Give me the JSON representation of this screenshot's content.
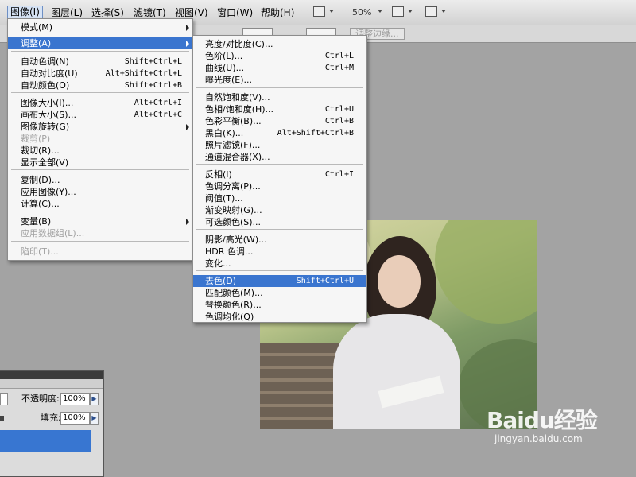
{
  "menubar": {
    "items": [
      "图像(I)",
      "图层(L)",
      "选择(S)",
      "滤镜(T)",
      "视图(V)",
      "窗口(W)",
      "帮助(H)"
    ],
    "zoom": "50%"
  },
  "options": {
    "adjust_edge": "调整边缘..."
  },
  "image_menu": {
    "items": [
      {
        "label": "模式(M)",
        "shortcut": ""
      },
      {
        "label": "调整(A)",
        "shortcut": ""
      },
      {
        "label": "自动色调(N)",
        "shortcut": "Shift+Ctrl+L"
      },
      {
        "label": "自动对比度(U)",
        "shortcut": "Alt+Shift+Ctrl+L"
      },
      {
        "label": "自动颜色(O)",
        "shortcut": "Shift+Ctrl+B"
      },
      {
        "label": "图像大小(I)...",
        "shortcut": "Alt+Ctrl+I"
      },
      {
        "label": "画布大小(S)...",
        "shortcut": "Alt+Ctrl+C"
      },
      {
        "label": "图像旋转(G)",
        "shortcut": ""
      },
      {
        "label": "裁剪(P)",
        "shortcut": ""
      },
      {
        "label": "裁切(R)...",
        "shortcut": ""
      },
      {
        "label": "显示全部(V)",
        "shortcut": ""
      },
      {
        "label": "复制(D)...",
        "shortcut": ""
      },
      {
        "label": "应用图像(Y)...",
        "shortcut": ""
      },
      {
        "label": "计算(C)...",
        "shortcut": ""
      },
      {
        "label": "变量(B)",
        "shortcut": ""
      },
      {
        "label": "应用数据组(L)...",
        "shortcut": ""
      },
      {
        "label": "陷印(T)...",
        "shortcut": ""
      }
    ]
  },
  "adjust_menu": {
    "items": [
      {
        "label": "亮度/对比度(C)...",
        "shortcut": ""
      },
      {
        "label": "色阶(L)...",
        "shortcut": "Ctrl+L"
      },
      {
        "label": "曲线(U)...",
        "shortcut": "Ctrl+M"
      },
      {
        "label": "曝光度(E)...",
        "shortcut": ""
      },
      {
        "label": "自然饱和度(V)...",
        "shortcut": ""
      },
      {
        "label": "色相/饱和度(H)...",
        "shortcut": "Ctrl+U"
      },
      {
        "label": "色彩平衡(B)...",
        "shortcut": "Ctrl+B"
      },
      {
        "label": "黑白(K)...",
        "shortcut": "Alt+Shift+Ctrl+B"
      },
      {
        "label": "照片滤镜(F)...",
        "shortcut": ""
      },
      {
        "label": "通道混合器(X)...",
        "shortcut": ""
      },
      {
        "label": "反相(I)",
        "shortcut": "Ctrl+I"
      },
      {
        "label": "色调分离(P)...",
        "shortcut": ""
      },
      {
        "label": "阈值(T)...",
        "shortcut": ""
      },
      {
        "label": "渐变映射(G)...",
        "shortcut": ""
      },
      {
        "label": "可选颜色(S)...",
        "shortcut": ""
      },
      {
        "label": "阴影/高光(W)...",
        "shortcut": ""
      },
      {
        "label": "HDR 色调...",
        "shortcut": ""
      },
      {
        "label": "变化...",
        "shortcut": ""
      },
      {
        "label": "去色(D)",
        "shortcut": "Shift+Ctrl+U"
      },
      {
        "label": "匹配颜色(M)...",
        "shortcut": ""
      },
      {
        "label": "替换颜色(R)...",
        "shortcut": ""
      },
      {
        "label": "色调均化(Q)",
        "shortcut": ""
      }
    ]
  },
  "layers_panel": {
    "opacity_label": "不透明度:",
    "opacity_value": "100%",
    "fill_label": "填充:",
    "fill_value": "100%"
  },
  "watermark": {
    "logo": "Baidu经验",
    "url": "jingyan.baidu.com"
  },
  "colors": {
    "highlight": "#3a75cf",
    "menu_bg": "#f6f6f6",
    "workspace": "#a3a3a3"
  }
}
